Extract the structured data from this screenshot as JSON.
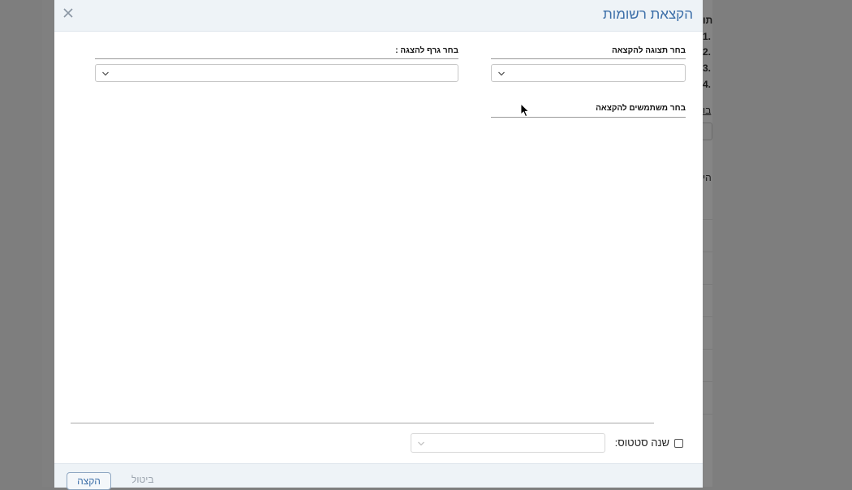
{
  "background": {
    "lines": [
      "תו",
      "1.",
      "2.",
      "3.",
      "4."
    ],
    "link_fragment": "בו",
    "heading_fragment": "הי"
  },
  "modal": {
    "title": "הקצאת רשומות",
    "close_icon": "close-icon",
    "fields": {
      "view_select_label": "בחר תצוגה להקצאה",
      "graph_select_label": "בחר גרף להצגה :",
      "users_label": "בחר משתמשים להקצאה"
    },
    "status": {
      "checkbox_checked": false,
      "label": "שנה סטטוס:"
    },
    "footer": {
      "assign_label": "הקצה",
      "cancel_label": "ביטול"
    }
  },
  "colors": {
    "title": "#3b6ea8",
    "header_bg": "#eef3f7",
    "overlay": "#7e7e7e"
  }
}
